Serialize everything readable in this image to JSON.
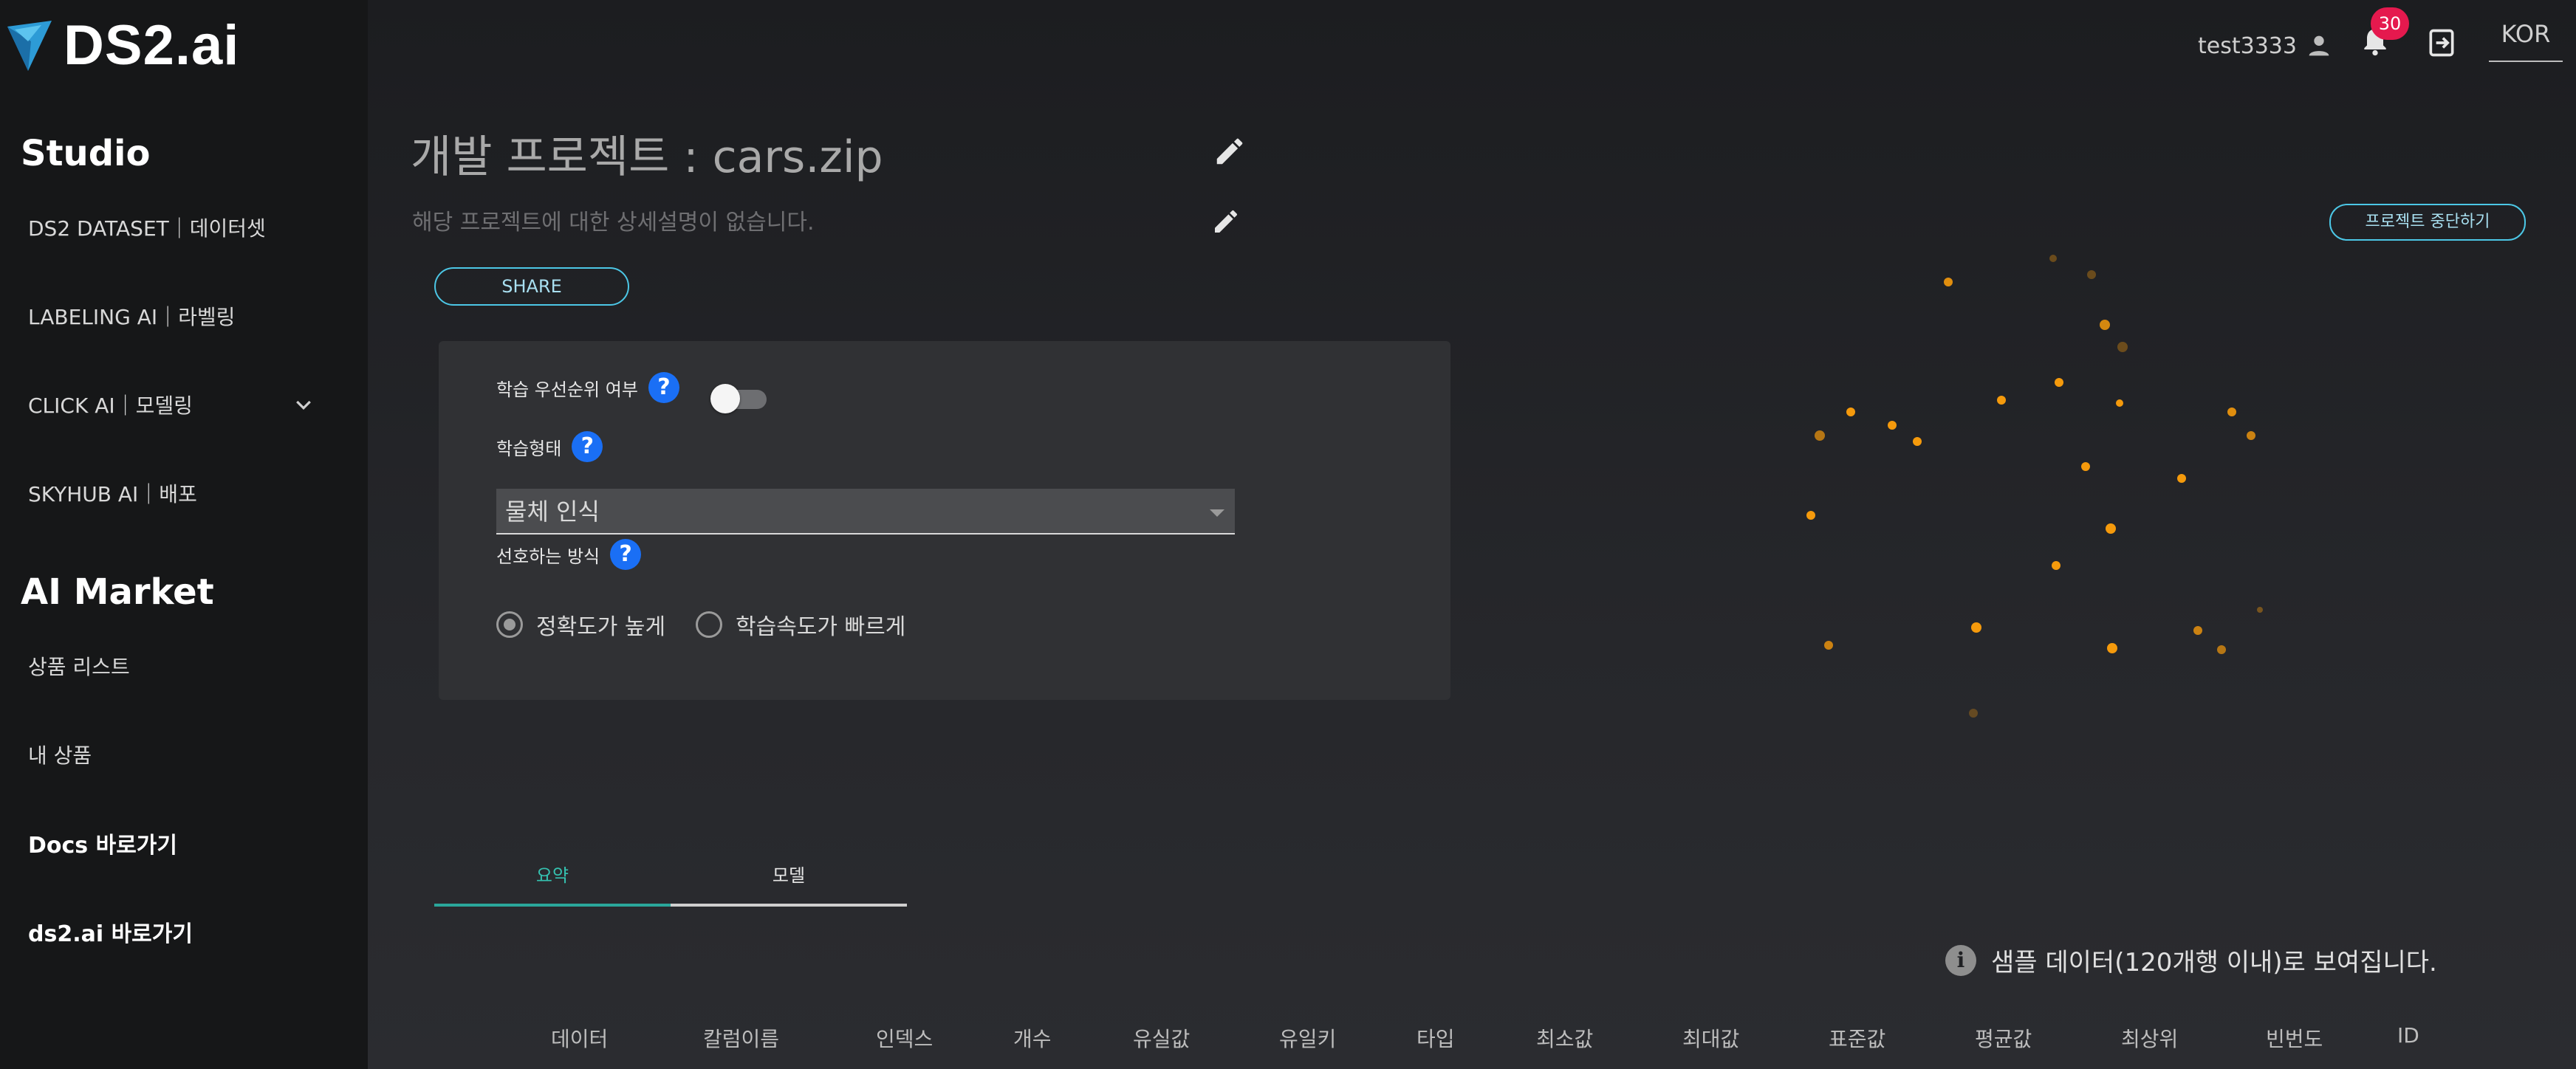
{
  "app": {
    "logo_text": "DS2.ai"
  },
  "sidebar": {
    "studio_title": "Studio",
    "studio_items": [
      {
        "label": "DS2 DATASET｜데이터셋"
      },
      {
        "label": "LABELING AI｜라벨링"
      },
      {
        "label": "CLICK AI｜모델링"
      },
      {
        "label": "SKYHUB AI｜배포"
      }
    ],
    "market_title": "AI Market",
    "market_items": [
      {
        "label": "상품 리스트"
      },
      {
        "label": "내 상품"
      }
    ],
    "links": [
      {
        "label": "Docs 바로가기"
      },
      {
        "label": "ds2.ai 바로가기"
      }
    ]
  },
  "header": {
    "username": "test3333",
    "notification_count": "30",
    "language": "KOR"
  },
  "project": {
    "title": "개발 프로젝트 : cars.zip",
    "description": "해당 프로젝트에 대한 상세설명이 없습니다.",
    "share_label": "SHARE",
    "stop_label": "프로젝트 중단하기"
  },
  "settings": {
    "priority_label": "학습 우선순위 여부",
    "priority_enabled": false,
    "training_type_label": "학습형태",
    "training_type_value": "물체 인식",
    "preference_label": "선호하는 방식",
    "preference_options": [
      {
        "label": "정확도가 높게",
        "checked": true
      },
      {
        "label": "학습속도가 빠르게",
        "checked": false
      }
    ],
    "help_glyph": "?"
  },
  "tabs": [
    {
      "label": "요약",
      "active": true
    },
    {
      "label": "모델",
      "active": false
    }
  ],
  "info": {
    "icon_glyph": "i",
    "text": "샘플 데이터(120개행 이내)로 보여집니다."
  },
  "table": {
    "columns": [
      "데이터",
      "칼럼이름",
      "인덱스",
      "개수",
      "유실값",
      "유일키",
      "타입",
      "최소값",
      "최대값",
      "표준값",
      "평균값",
      "최상위",
      "빈번도",
      "ID"
    ]
  },
  "colors": {
    "accent": "#4cc7e6",
    "tab_active": "#35c2b0",
    "badge": "#e5194e",
    "help": "#1a6ff5",
    "dot": "#f59a0c"
  }
}
